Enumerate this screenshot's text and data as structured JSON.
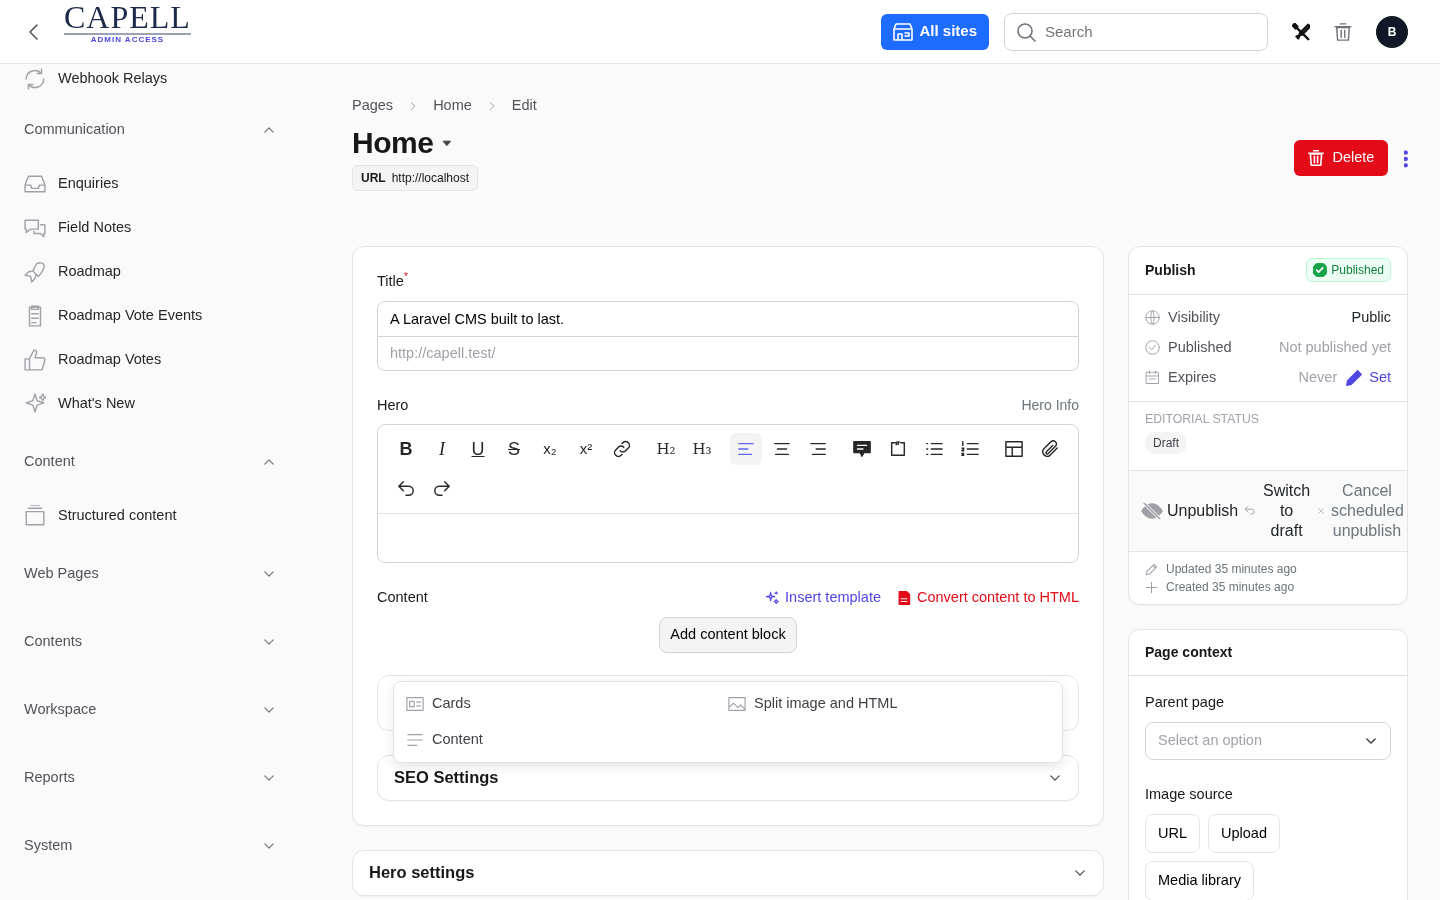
{
  "header": {
    "logo": {
      "wordmark": "CAPELL",
      "tagline": "ADMIN ACCESS"
    },
    "sites_button": "All sites",
    "search": {
      "placeholder": "Search"
    },
    "avatar": "B"
  },
  "sidebar": {
    "items": [
      {
        "kind": "item",
        "label": "Webhook Relays"
      },
      {
        "kind": "section",
        "label": "Communication",
        "expanded": true,
        "children": [
          {
            "label": "Enquiries"
          },
          {
            "label": "Field Notes"
          },
          {
            "label": "Roadmap"
          },
          {
            "label": "Roadmap Vote Events"
          },
          {
            "label": "Roadmap Votes"
          },
          {
            "label": "What's New"
          }
        ]
      },
      {
        "kind": "section",
        "label": "Content",
        "expanded": true,
        "children": [
          {
            "label": "Structured content"
          }
        ]
      },
      {
        "kind": "section",
        "label": "Web Pages",
        "expanded": false
      },
      {
        "kind": "section",
        "label": "Contents",
        "expanded": false
      },
      {
        "kind": "section",
        "label": "Workspace",
        "expanded": false
      },
      {
        "kind": "section",
        "label": "Reports",
        "expanded": false
      },
      {
        "kind": "section",
        "label": "System",
        "expanded": false
      }
    ]
  },
  "breadcrumbs": [
    "Pages",
    "Home",
    "Edit"
  ],
  "page": {
    "title": "Home",
    "url_label": "URL",
    "url": "http://localhost",
    "delete_button": "Delete"
  },
  "form": {
    "title_label": "Title$^{*}$",
    "title_value": "A Laravel CMS built to last.",
    "slug_placeholder": "http://capell.test/",
    "hero_label": "Hero",
    "hero_info": "Hero Info",
    "toolbar": [
      {
        "kind": "bold",
        "label": "B",
        "selected": false
      },
      {
        "kind": "italic",
        "label": "I",
        "selected": false
      },
      {
        "kind": "underline",
        "label": "U",
        "selected": false
      },
      {
        "kind": "strike",
        "label": "S",
        "selected": false
      },
      {
        "kind": "sub",
        "label": "x₂",
        "selected": false
      },
      {
        "kind": "sup",
        "label": "x²",
        "selected": false
      },
      {
        "kind": "link",
        "selected": false
      },
      {
        "kind": "heading",
        "label": "H₂",
        "selected": false
      },
      {
        "kind": "heading",
        "label": "H₃",
        "selected": false
      },
      {
        "kind": "align-left",
        "selected": true
      },
      {
        "kind": "align-center",
        "selected": false
      },
      {
        "kind": "align-right",
        "selected": false
      },
      {
        "kind": "comment",
        "selected": false
      },
      {
        "kind": "code",
        "selected": false
      },
      {
        "kind": "bullets",
        "selected": false
      },
      {
        "kind": "numbers",
        "selected": false
      },
      {
        "kind": "table",
        "selected": false
      },
      {
        "kind": "clip",
        "selected": false
      },
      {
        "kind": "undo",
        "selected": false
      },
      {
        "kind": "redo",
        "selected": false
      }
    ],
    "content_label": "Content",
    "insert_template": "Insert template",
    "convert": "Convert content to HTML",
    "add_block": "Add content block",
    "block_menu": [
      "Cards",
      "Split image and HTML",
      "Content"
    ],
    "seo": {
      "label": "SEO Settings",
      "expanded": false
    }
  },
  "hero_settings": {
    "label": "Hero settings",
    "expanded": false
  },
  "publish": {
    "title": "Publish",
    "status": "Published",
    "rows": [
      {
        "label": "Visibility",
        "value": "Public",
        "strong": true
      },
      {
        "label": "Published",
        "value": "Not published yet",
        "strong": false
      },
      {
        "label": "Expires",
        "value": "Never",
        "strong": false,
        "action": "Set"
      }
    ],
    "editorial_label": "EDITORIAL STATUS",
    "editorial_value": "Draft",
    "actions": [
      "Unpublish",
      "Switch to draft",
      "Cancel scheduled unpublish"
    ],
    "updated": "Updated 35 minutes ago",
    "created": "Created 35 minutes ago"
  },
  "context": {
    "title": "Page context",
    "parent_label": "Parent page",
    "parent_placeholder": "Select an option",
    "image_label": "Image source",
    "image_buttons": [
      "URL",
      "Upload",
      "Media library"
    ]
  }
}
